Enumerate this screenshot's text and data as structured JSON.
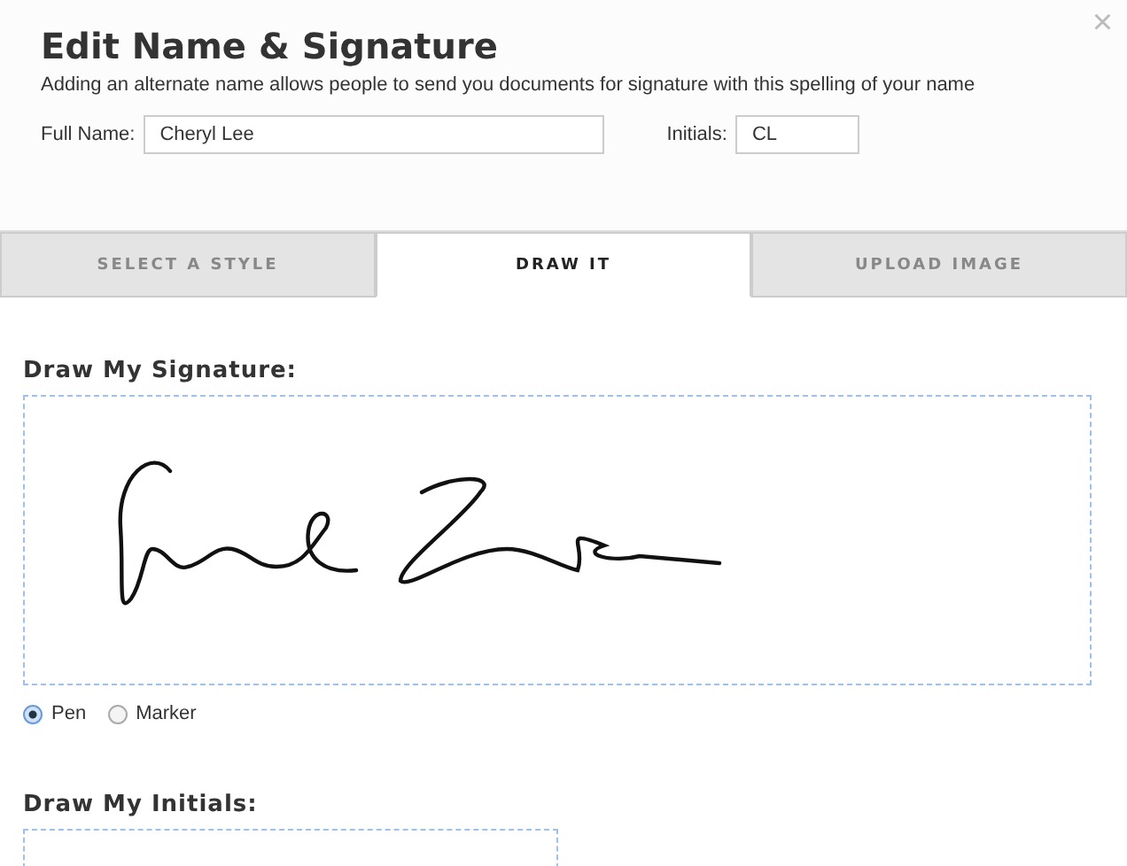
{
  "dialog": {
    "title": "Edit Name & Signature",
    "description": "Adding an alternate name allows people to send you documents for signature with this spelling of your name",
    "close": "×"
  },
  "fields": {
    "full_name": {
      "label": "Full Name:",
      "value": "Cheryl Lee"
    },
    "initials": {
      "label": "Initials:",
      "value": "CL"
    }
  },
  "tabs": [
    {
      "label": "SELECT A STYLE",
      "selected": false
    },
    {
      "label": "DRAW IT",
      "selected": true
    },
    {
      "label": "UPLOAD IMAGE",
      "selected": false
    }
  ],
  "signature": {
    "heading": "Draw My Signature:"
  },
  "pen_options": [
    {
      "label": "Pen",
      "selected": true
    },
    {
      "label": "Marker",
      "selected": false
    }
  ],
  "initials_pad": {
    "heading": "Draw My Initials:"
  }
}
